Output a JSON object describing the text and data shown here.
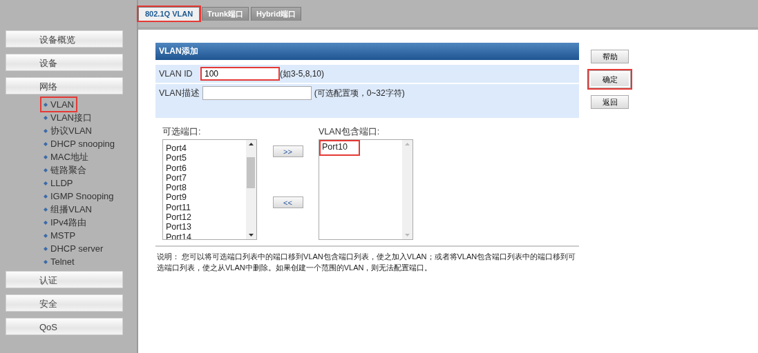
{
  "tabs": [
    {
      "label": "802.1Q VLAN",
      "selected": true,
      "highlighted": true
    },
    {
      "label": "Trunk端口",
      "selected": false,
      "highlighted": false
    },
    {
      "label": "Hybrid端口",
      "selected": false,
      "highlighted": false
    }
  ],
  "sidebar": {
    "items": [
      {
        "label": "设备概览"
      },
      {
        "label": "设备"
      },
      {
        "label": "网络",
        "children": [
          {
            "label": "VLAN",
            "highlighted": true
          },
          {
            "label": "VLAN接口",
            "highlighted": false
          },
          {
            "label": "协议VLAN",
            "highlighted": false
          },
          {
            "label": "DHCP snooping",
            "highlighted": false
          },
          {
            "label": "MAC地址",
            "highlighted": false
          },
          {
            "label": "链路聚合",
            "highlighted": false
          },
          {
            "label": "LLDP",
            "highlighted": false
          },
          {
            "label": "IGMP Snooping",
            "highlighted": false
          },
          {
            "label": "组播VLAN",
            "highlighted": false
          },
          {
            "label": "IPv4路由",
            "highlighted": false
          },
          {
            "label": "MSTP",
            "highlighted": false
          },
          {
            "label": "DHCP server",
            "highlighted": false
          },
          {
            "label": "Telnet",
            "highlighted": false
          }
        ]
      },
      {
        "label": "认证"
      },
      {
        "label": "安全"
      },
      {
        "label": "QoS"
      }
    ]
  },
  "form": {
    "title": "VLAN添加",
    "vlan_id": {
      "label": "VLAN ID",
      "value": "100",
      "hint": "(如3-5,8,10)",
      "highlighted": true
    },
    "description": {
      "label": "VLAN描述",
      "hint": "(可选配置项，0~32字符)"
    },
    "available_ports": {
      "label": "可选端口:",
      "items": [
        {
          "label": "Port4",
          "highlighted": false
        },
        {
          "label": "Port5",
          "highlighted": false
        },
        {
          "label": "Port6",
          "highlighted": false
        },
        {
          "label": "Port7",
          "highlighted": false
        },
        {
          "label": "Port8",
          "highlighted": false
        },
        {
          "label": "Port9",
          "highlighted": false
        },
        {
          "label": "Port11",
          "highlighted": false
        },
        {
          "label": "Port12",
          "highlighted": false
        },
        {
          "label": "Port13",
          "highlighted": false
        },
        {
          "label": "Port14",
          "highlighted": false
        }
      ]
    },
    "move_buttons": [
      {
        "label": ">>"
      },
      {
        "label": "<<"
      }
    ],
    "member_ports": {
      "label": "VLAN包含端口:",
      "items": [
        {
          "label": "Port10",
          "highlighted": true
        }
      ]
    },
    "note": "说明：  您可以将可选端口列表中的端口移到VLAN包含端口列表，使之加入VLAN；或者将VLAN包含端口列表中的端口移到可选端口列表，使之从VLAN中删除。如果创建一个范围的VLAN，则无法配置端口。"
  },
  "buttons": [
    {
      "label": "帮助",
      "highlighted": false
    },
    {
      "label": "确定",
      "highlighted": true
    },
    {
      "label": "返回",
      "highlighted": false
    }
  ]
}
